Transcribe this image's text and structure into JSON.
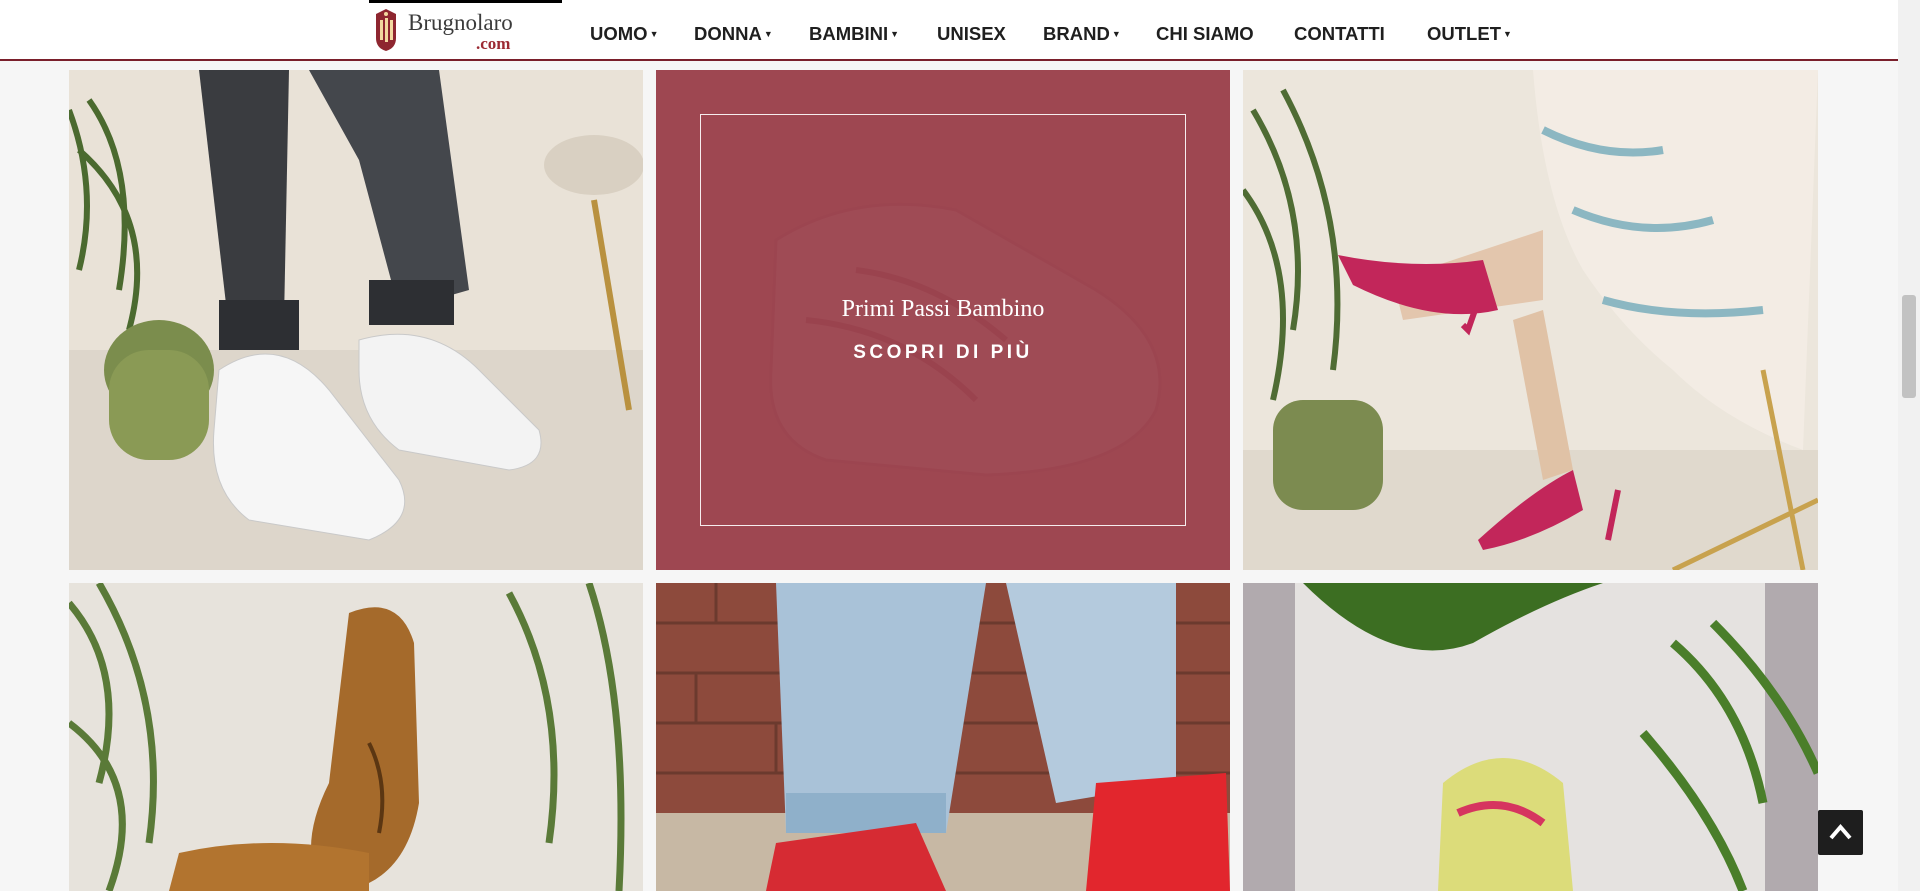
{
  "header": {
    "logo": {
      "name": "Brugnolaro",
      "domain": ".com",
      "seal_letters": "GB"
    },
    "nav": [
      {
        "label": "UOMO",
        "dropdown": true
      },
      {
        "label": "DONNA",
        "dropdown": true
      },
      {
        "label": "BAMBINI",
        "dropdown": true
      },
      {
        "label": "UNISEX",
        "dropdown": false
      },
      {
        "label": "BRAND",
        "dropdown": true
      },
      {
        "label": "CHI SIAMO",
        "dropdown": false
      },
      {
        "label": "CONTATTI",
        "dropdown": false
      },
      {
        "label": "OUTLET",
        "dropdown": true
      }
    ]
  },
  "tiles": {
    "promo": {
      "title": "Primi Passi Bambino",
      "cta": "SCOPRI DI PIÙ"
    }
  },
  "icons": {
    "dropdown": "caret-down-icon",
    "back_to_top": "chevron-up-icon"
  },
  "colors": {
    "brand_red": "#9c2a33",
    "overlay": "#92323e",
    "header_rule": "#7a1f2b",
    "nav_text": "#1f1f1f"
  }
}
